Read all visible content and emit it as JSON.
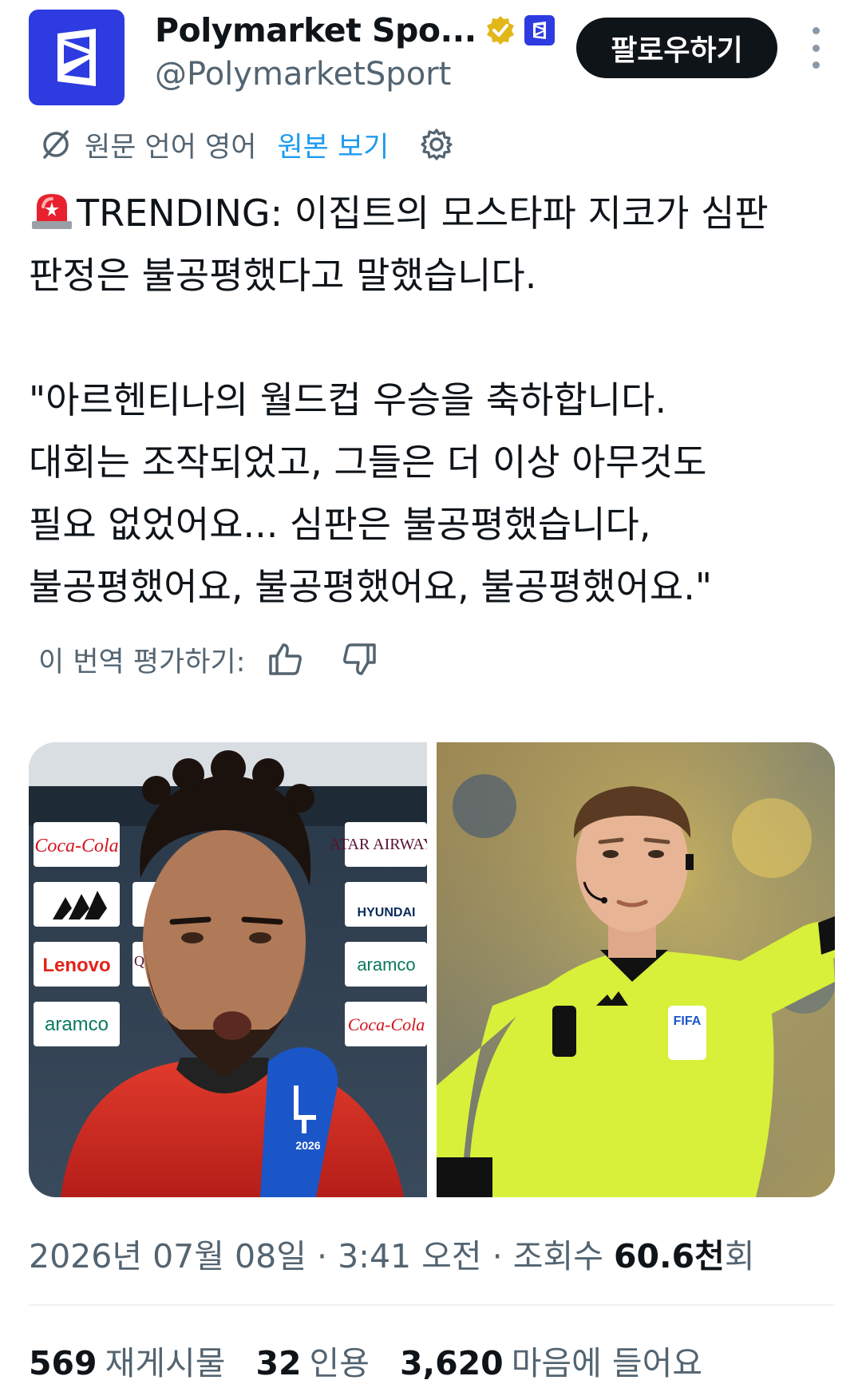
{
  "header": {
    "display_name": "Polymarket Spo...",
    "handle": "@PolymarketSport",
    "follow_label": "팔로우하기"
  },
  "translation": {
    "source_lang": "원문 언어 영어",
    "view_original": "원본 보기"
  },
  "tweet": {
    "lines": [
      "TRENDING: 이집트의 모스타파 지코가 심판",
      "판정은 불공평했다고 말했습니다.",
      "\"아르헨티나의 월드컵 우승을 축하합니다.",
      "대회는 조작되었고, 그들은 더 이상 아무것도",
      "필요 없었어요... 심판은 불공평했습니다,",
      "불공평했어요, 불공평했어요, 불공평했어요.\""
    ]
  },
  "rate": {
    "label": "이 번역 평가하기:"
  },
  "media": {
    "photo1": {
      "sponsors": [
        "Coca-Cola",
        "Lenovo",
        "aramco",
        "ATAR AIRWAYS",
        "HYUNDAI",
        "aramco",
        "Coca-Cola",
        "QA AIR"
      ]
    },
    "photo2": {
      "badge": "FIFA"
    }
  },
  "meta": {
    "date": "2026년 07월 08일",
    "sep1": "·",
    "time": "3:41 오전",
    "sep2": "·",
    "views_label": "조회수",
    "views_count": "60.6천",
    "views_suffix": "회"
  },
  "stats": {
    "reposts_count": "569",
    "reposts_label": "재게시물",
    "quotes_count": "32",
    "quotes_label": "인용",
    "likes_count": "3,620",
    "likes_label": "마음에 들어요"
  },
  "colors": {
    "brand_blue": "#2d3be0",
    "link_blue": "#1d9bf0",
    "verified_gold": "#e2b719",
    "text_primary": "#0f1419",
    "text_secondary": "#536471"
  },
  "icons": [
    "polymarket-logo-icon",
    "verified-badge-icon",
    "affiliate-badge-icon",
    "translate-icon",
    "gear-icon",
    "siren-icon",
    "thumbs-up-icon",
    "thumbs-down-icon",
    "more-icon"
  ]
}
